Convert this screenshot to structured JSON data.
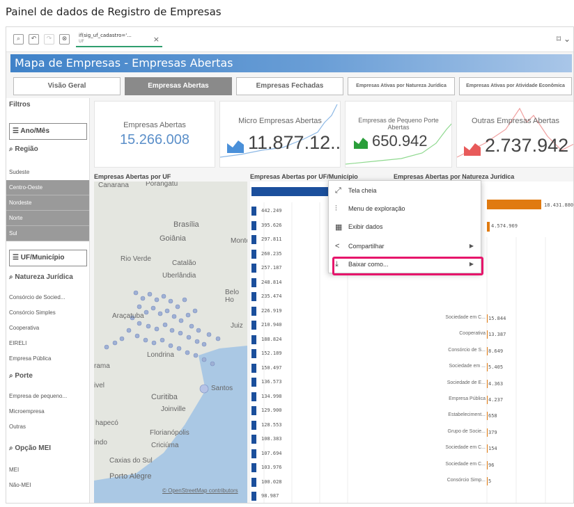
{
  "page_title": "Painel de dados de Registro de Empresas",
  "toolbar": {
    "chip_title": "if(sig_uf_cadastro='...",
    "chip_sub": "UF",
    "chip_close": "×",
    "bookmark": "⌑ ⌄"
  },
  "sheet_title": "Mapa de Empresas - Empresas Abertas",
  "tabs": [
    "Visão Geral",
    "Empresas Abertas",
    "Empresas Fechadas",
    "Empresas Ativas por Natureza Jurídica",
    "Empresas Ativas por Atividade Econômica"
  ],
  "filters": {
    "title": "Filtros",
    "ano_mes": "Ano/Mês",
    "regiao_label": "Região",
    "regiao_items": [
      "Sudeste",
      "Centro-Oeste",
      "Nordeste",
      "Norte",
      "Sul"
    ],
    "uf_municipio": "UF/Município",
    "natureza_label": "Natureza Jurídica",
    "natureza_items": [
      "Consórcio de Socied...",
      "Consórcio Simples",
      "Cooperativa",
      "EIRELI",
      "Empresa Pública"
    ],
    "porte_label": "Porte",
    "porte_items": [
      "Empresa de pequeno...",
      "Microempresa",
      "Outras"
    ],
    "mei_label": "Opção MEI",
    "mei_items": [
      "MEI",
      "Não-MEI"
    ]
  },
  "kpis": {
    "abertas_label": "Empresas Abertas",
    "abertas_value": "15.266.008",
    "micro_label": "Micro Empresas Abertas",
    "micro_value": "11.877.12...",
    "pequeno_label": "Empresas de Pequeno Porte Abertas",
    "pequeno_value": "650.942",
    "outras_label": "Outras Empresas Abertas",
    "outras_value": "2.737.942"
  },
  "map": {
    "title": "Empresas Abertas por UF",
    "credit": "© OpenStreetMap contributors",
    "places": [
      "Canarana",
      "Porangatu",
      "Brasília",
      "Goiânia",
      "Montes",
      "Rio Verde",
      "Catalão",
      "Uberlândia",
      "Belo Ho",
      "Araçatuba",
      "Juiz",
      "Londrina",
      "rama",
      "ivel",
      "Curitiba",
      "Joinville",
      "hapecó",
      "Florianópolis",
      "indo",
      "Criciúma",
      "Caxias do Sul",
      "Porto Alegre",
      "Santos"
    ]
  },
  "bars": {
    "title": "Empresas Abertas por UF/Município",
    "values": [
      "442.249",
      "395.626",
      "297.811",
      "260.235",
      "257.187",
      "248.814",
      "235.474",
      "226.919",
      "210.940",
      "188.824",
      "152.189",
      "150.497",
      "136.573",
      "134.998",
      "129.900",
      "128.553",
      "108.383",
      "107.694",
      "103.976",
      "100.028",
      "98.987"
    ]
  },
  "natureza": {
    "title": "Empresas Abertas por Natureza Jurídica",
    "top_value": "18.431.880",
    "second_value": "4.574.969",
    "rows": [
      {
        "label": "Sociedade em C...",
        "value": "15.844"
      },
      {
        "label": "Cooperativa",
        "value": "13.387"
      },
      {
        "label": "Consórcio de S...",
        "value": "8.649"
      },
      {
        "label": "Sociedade em ...",
        "value": "5.405"
      },
      {
        "label": "Sociedade de E...",
        "value": "4.363"
      },
      {
        "label": "Empresa Pública",
        "value": "4.237"
      },
      {
        "label": "Estabeleciment...",
        "value": "658"
      },
      {
        "label": "Grupo de Socie...",
        "value": "379"
      },
      {
        "label": "Sociedade em C...",
        "value": "154"
      },
      {
        "label": "Sociedade em C...",
        "value": "96"
      },
      {
        "label": "Consórcio Simp...",
        "value": "5"
      }
    ]
  },
  "context_menu": {
    "items": [
      "Tela cheia",
      "Menu de exploração",
      "Exibir dados",
      "Compartilhar",
      "Baixar como..."
    ]
  },
  "colors": {
    "accent": "#1b4f9c",
    "orange": "#e07a10",
    "highlight": "#e6156b",
    "green": "#2a9e3a",
    "red": "#e85a5a"
  }
}
